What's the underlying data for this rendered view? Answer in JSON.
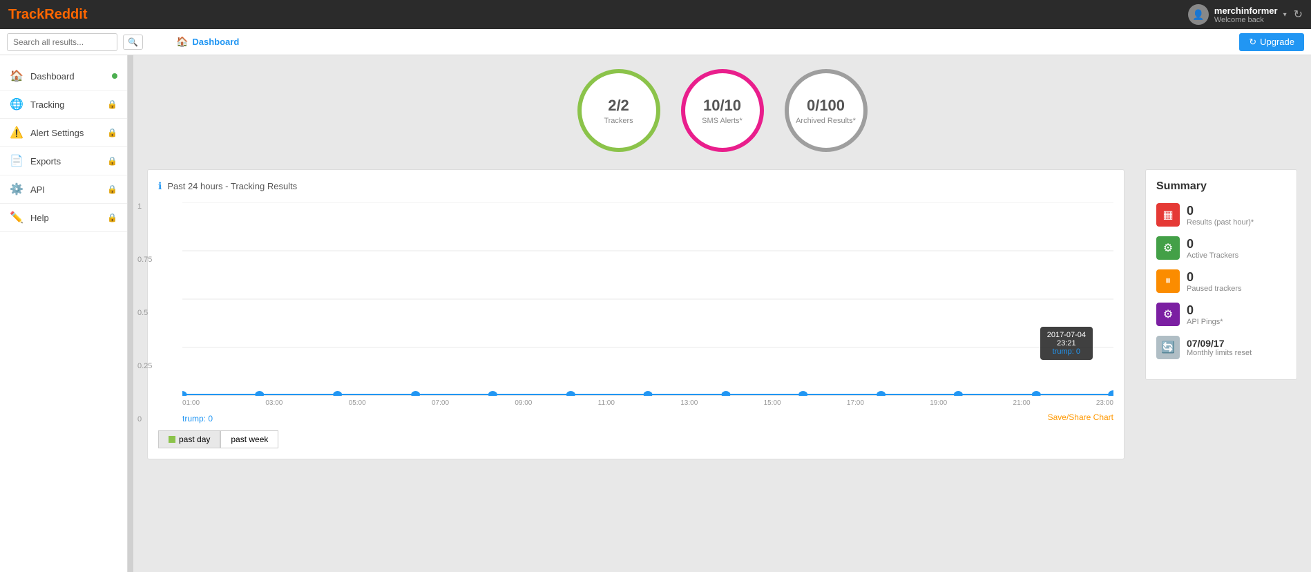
{
  "topnav": {
    "logo_track": "Track",
    "logo_reddit": "Reddit",
    "username": "merchinformer",
    "welcome": "Welcome back",
    "upgrade_label": "Upgrade",
    "refresh_icon": "↻"
  },
  "searchbar": {
    "placeholder": "Search all results...",
    "search_icon": "🔍",
    "breadcrumb_home": "🏠",
    "breadcrumb_label": "Dashboard"
  },
  "sidebar": {
    "items": [
      {
        "label": "Dashboard",
        "icon": "🏠",
        "has_dot": true,
        "has_lock": false
      },
      {
        "label": "Tracking",
        "icon": "🌐",
        "has_dot": false,
        "has_lock": true
      },
      {
        "label": "Alert Settings",
        "icon": "⚠️",
        "has_dot": false,
        "has_lock": true
      },
      {
        "label": "Exports",
        "icon": "📄",
        "has_dot": false,
        "has_lock": true
      },
      {
        "label": "API",
        "icon": "⚙️",
        "has_dot": false,
        "has_lock": true
      },
      {
        "label": "Help",
        "icon": "✏️",
        "has_dot": false,
        "has_lock": true
      }
    ]
  },
  "circles": [
    {
      "value": "2/2",
      "label": "Trackers",
      "color": "green"
    },
    {
      "value": "10/10",
      "label": "SMS Alerts*",
      "color": "pink"
    },
    {
      "value": "0/100",
      "label": "Archived Results*",
      "color": "gray"
    }
  ],
  "chart": {
    "title": "Past 24 hours - Tracking Results",
    "info_icon": "ℹ",
    "y_labels": [
      "1",
      "0.75",
      "0.5",
      "0.25",
      "0"
    ],
    "x_labels": [
      "01:00",
      "03:00",
      "05:00",
      "07:00",
      "09:00",
      "11:00",
      "13:00",
      "15:00",
      "17:00",
      "19:00",
      "21:00",
      "23:00"
    ],
    "tracker_label": "trump: 0",
    "save_label": "Save/Share Chart",
    "tooltip": {
      "date": "2017-07-04",
      "time": "23:21",
      "tracker": "trump",
      "value": "0"
    }
  },
  "time_buttons": [
    {
      "label": "past day",
      "active": true
    },
    {
      "label": "past week",
      "active": false
    }
  ],
  "summary": {
    "title": "Summary",
    "items": [
      {
        "count": "0",
        "desc": "Results (past hour)*",
        "icon": "▦",
        "color": "red"
      },
      {
        "count": "0",
        "desc": "Active Trackers",
        "icon": "⚙",
        "color": "green"
      },
      {
        "count": "0",
        "desc": "Paused trackers",
        "icon": "⏸",
        "color": "orange"
      },
      {
        "count": "0",
        "desc": "API Pings*",
        "icon": "⚙",
        "color": "purple"
      },
      {
        "count": "07/09/17",
        "desc": "Monthly limits reset",
        "icon": "🔄",
        "color": "gray"
      }
    ]
  }
}
